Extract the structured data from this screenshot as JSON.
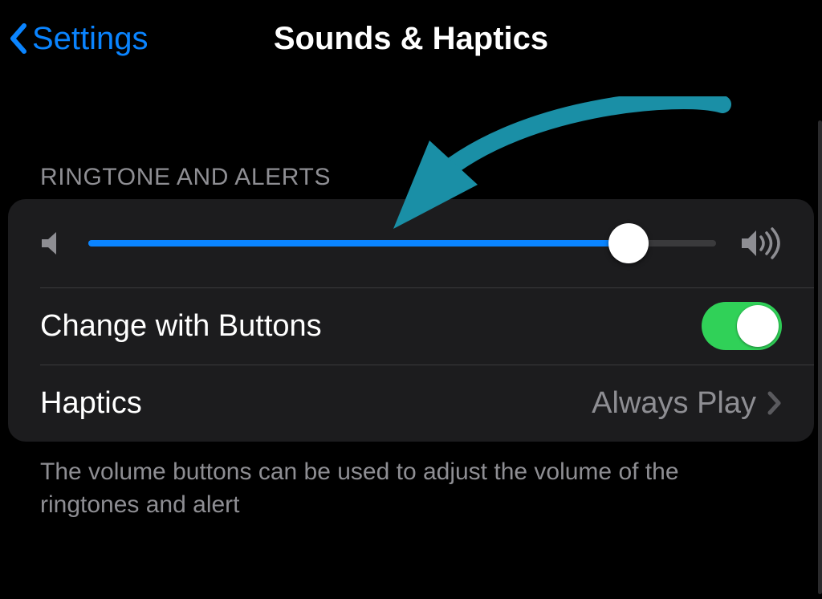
{
  "nav": {
    "back_label": "Settings",
    "title": "Sounds & Haptics"
  },
  "section": {
    "header": "RINGTONE AND ALERTS",
    "footer": "The volume buttons can be used to adjust the volume of the ringtones and alert"
  },
  "slider": {
    "value_percent": 86
  },
  "rows": {
    "change_with_buttons": {
      "label": "Change with Buttons",
      "on": true
    },
    "haptics": {
      "label": "Haptics",
      "value": "Always Play"
    }
  },
  "colors": {
    "accent": "#0a84ff",
    "toggle_on": "#30d158",
    "annotation": "#1a8fa6"
  },
  "icons": {
    "back": "chevron-left-icon",
    "vol_low": "volume-low-icon",
    "vol_high": "volume-high-icon",
    "disclosure": "chevron-right-icon"
  }
}
